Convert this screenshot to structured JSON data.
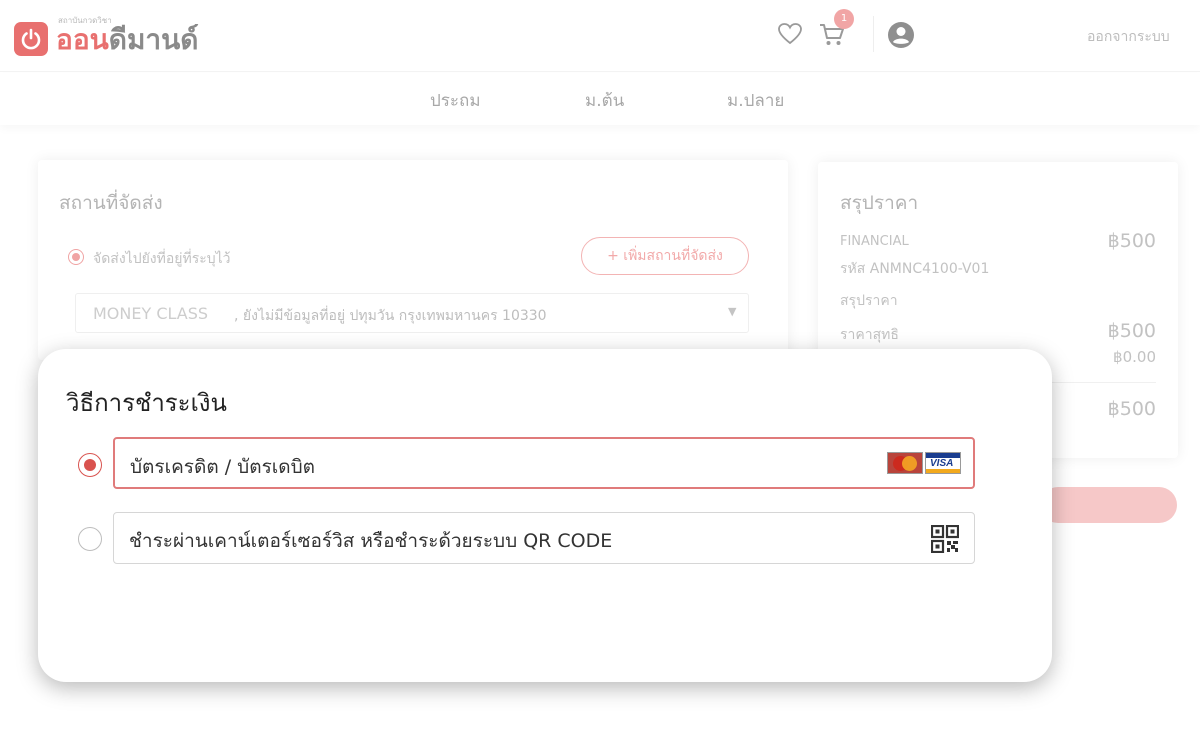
{
  "header": {
    "logo_small": "สถาบันกวดวิชา",
    "logo_part1": "ออน",
    "logo_part2": "ดีมานด์",
    "cart_count": "1",
    "logout_label": "ออกจากระบบ"
  },
  "nav": {
    "items": [
      {
        "label": "ประถม"
      },
      {
        "label": "ม.ต้น"
      },
      {
        "label": "ม.ปลาย"
      }
    ]
  },
  "shipping": {
    "title": "สถานที่จัดส่ง",
    "option_label": "จัดส่งไปยังที่อยู่ที่ระบุไว้",
    "add_button_label": "+ เพิ่มสถานที่จัดส่ง",
    "address_name": "MONEY  CLASS",
    "address_rest": ", ยังไม่มีข้อมูลที่อยู่ ปทุมวัน กรุงเทพมหานคร 10330"
  },
  "summary": {
    "title": "สรุปราคา",
    "product_name": "FINANCIAL",
    "product_code": "รหัส  ANMNC4100-V01",
    "product_price": "฿500",
    "subtitle": "สรุปราคา",
    "net_label": "ราคาสุทธิ",
    "net_value": "฿500",
    "discount_value": "฿0.00",
    "total_value": "฿500"
  },
  "payment": {
    "title": "วิธีการชำระเงิน",
    "options": [
      {
        "label": "บัตรเครดิต / บัตรเดบิต",
        "selected": true,
        "icon": "credit-card-brands-icon"
      },
      {
        "label": "ชำระผ่านเคาน์เตอร์เซอร์วิส หรือชำระด้วยระบบ QR CODE",
        "selected": false,
        "icon": "qr-code-icon"
      }
    ]
  },
  "colors": {
    "brand": "#e8706f",
    "selected_border": "#e07b7b",
    "radio_selected": "#d9534f"
  }
}
